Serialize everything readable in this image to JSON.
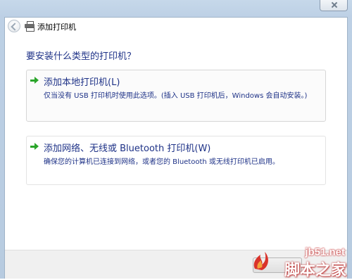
{
  "window": {
    "title": "添加打印机"
  },
  "main": {
    "heading": "要安装什么类型的打印机？",
    "options": [
      {
        "title": "添加本地打印机(L)",
        "description": "仅当没有 USB 打印机时使用此选项。(插入 USB 打印机后，Windows 会自动安装。)"
      },
      {
        "title": "添加网络、无线或 Bluetooth 打印机(W)",
        "description": "确保您的计算机已连接到网络，或者您的 Bluetooth 或无线打印机已启用。"
      }
    ]
  },
  "watermark": {
    "url": "jb51.net",
    "name": "脚本之家"
  },
  "colors": {
    "link_blue": "#1e3287",
    "arrow_green": "#2aa52a"
  }
}
